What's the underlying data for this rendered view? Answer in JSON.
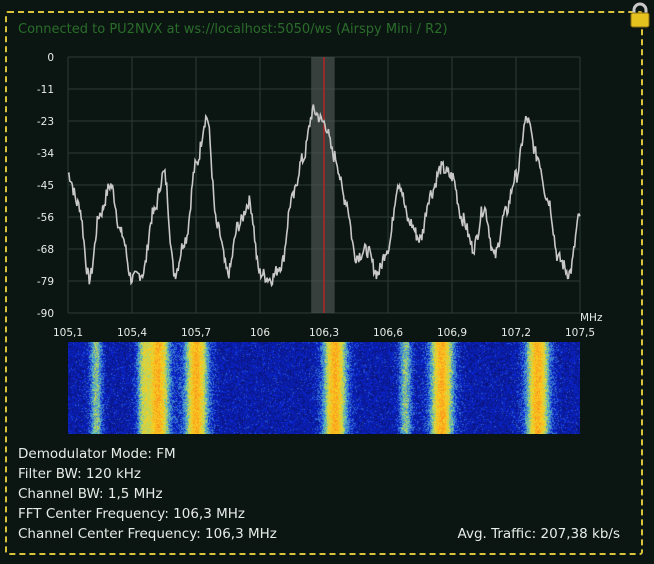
{
  "status": "Connected to PU2NVX at ws://localhost:5050/ws (Airspy Mini / R2)",
  "lock_icon": "padlock-icon",
  "colors": {
    "trace": "#c8c8c8",
    "grid": "#2c3a36",
    "marker": "#d02020",
    "band": "#4a524e",
    "frame": "#d9c33a"
  },
  "chart_data": {
    "type": "line",
    "x_unit": "MHz",
    "xlim": [
      105.1,
      107.5
    ],
    "ylim": [
      -90,
      0
    ],
    "y_ticks": [
      "0",
      "-11",
      "-23",
      "-34",
      "-45",
      "-56",
      "-68",
      "-79",
      "-90"
    ],
    "x_ticks": [
      "105,1",
      "105,4",
      "105,7",
      "106",
      "106,3",
      "106,6",
      "106,9",
      "107,2",
      "107,5"
    ],
    "center_frequency": 106.3,
    "channel_band": [
      106.24,
      106.35
    ],
    "grid": true,
    "x": [
      105.1,
      105.15,
      105.2,
      105.25,
      105.3,
      105.35,
      105.4,
      105.45,
      105.5,
      105.55,
      105.6,
      105.65,
      105.7,
      105.75,
      105.8,
      105.85,
      105.9,
      105.95,
      106.0,
      106.05,
      106.1,
      106.15,
      106.2,
      106.25,
      106.3,
      106.35,
      106.4,
      106.45,
      106.5,
      106.55,
      106.6,
      106.65,
      106.7,
      106.75,
      106.8,
      106.85,
      106.9,
      106.95,
      107.0,
      107.05,
      107.1,
      107.15,
      107.2,
      107.25,
      107.3,
      107.35,
      107.4,
      107.45,
      107.5
    ],
    "values": [
      -41,
      -52,
      -78,
      -55,
      -45,
      -62,
      -78,
      -76,
      -55,
      -41,
      -76,
      -64,
      -38,
      -21,
      -60,
      -76,
      -59,
      -51,
      -76,
      -78,
      -73,
      -50,
      -36,
      -19,
      -23,
      -35,
      -50,
      -70,
      -68,
      -76,
      -67,
      -44,
      -58,
      -64,
      -48,
      -39,
      -42,
      -57,
      -67,
      -53,
      -70,
      -55,
      -42,
      -22,
      -35,
      -50,
      -71,
      -76,
      -56
    ]
  },
  "waterfall": {
    "hot_bands_mhz": [
      105.52,
      105.7,
      106.35,
      106.85,
      107.3
    ],
    "medium_bands_mhz": [
      105.23,
      105.45,
      106.68
    ]
  },
  "info": {
    "demod": "Demodulator Mode: FM",
    "filter_bw": "Filter BW: 120 kHz",
    "channel_bw": "Channel BW: 1,5 MHz",
    "fft_center": "FFT Center Frequency: 106,3 MHz",
    "channel_center": "Channel Center Frequency: 106,3 MHz",
    "traffic": "Avg. Traffic: 207,38 kb/s"
  }
}
